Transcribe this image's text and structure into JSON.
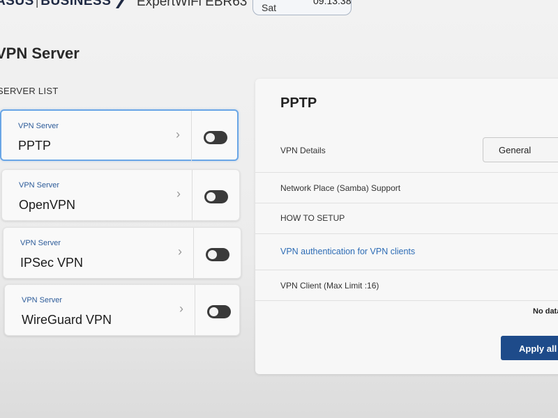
{
  "header": {
    "brand": "ASUS",
    "brand_suffix": "BUSINESS",
    "model": "ExpertWiFi EBR63",
    "day": "Sat",
    "time": "09:13:38"
  },
  "page": {
    "title": "VPN Server",
    "list_heading": "SERVER LIST"
  },
  "servers": [
    {
      "type_label": "VPN Server",
      "name": "PPTP",
      "enabled": false,
      "selected": true
    },
    {
      "type_label": "VPN Server",
      "name": "OpenVPN",
      "enabled": false,
      "selected": false
    },
    {
      "type_label": "VPN Server",
      "name": "IPSec VPN",
      "enabled": false,
      "selected": false
    },
    {
      "type_label": "VPN Server",
      "name": "WireGuard VPN",
      "enabled": false,
      "selected": false
    }
  ],
  "detail": {
    "title": "PPTP",
    "vpn_details_label": "VPN Details",
    "vpn_details_value": "General",
    "samba_label": "Network Place (Samba) Support",
    "how_to_setup": "HOW TO SETUP",
    "auth_link": "VPN authentication for VPN clients",
    "client_label": "VPN Client (Max Limit :16)",
    "no_data": "No data",
    "apply_label": "Apply all settings"
  },
  "colors": {
    "accent": "#1e4b8a",
    "link": "#2d6cb5",
    "selected_border": "#6aa6e6"
  },
  "icons": {
    "chevron": "chevron-right-icon",
    "toggle": "toggle-switch-off"
  }
}
